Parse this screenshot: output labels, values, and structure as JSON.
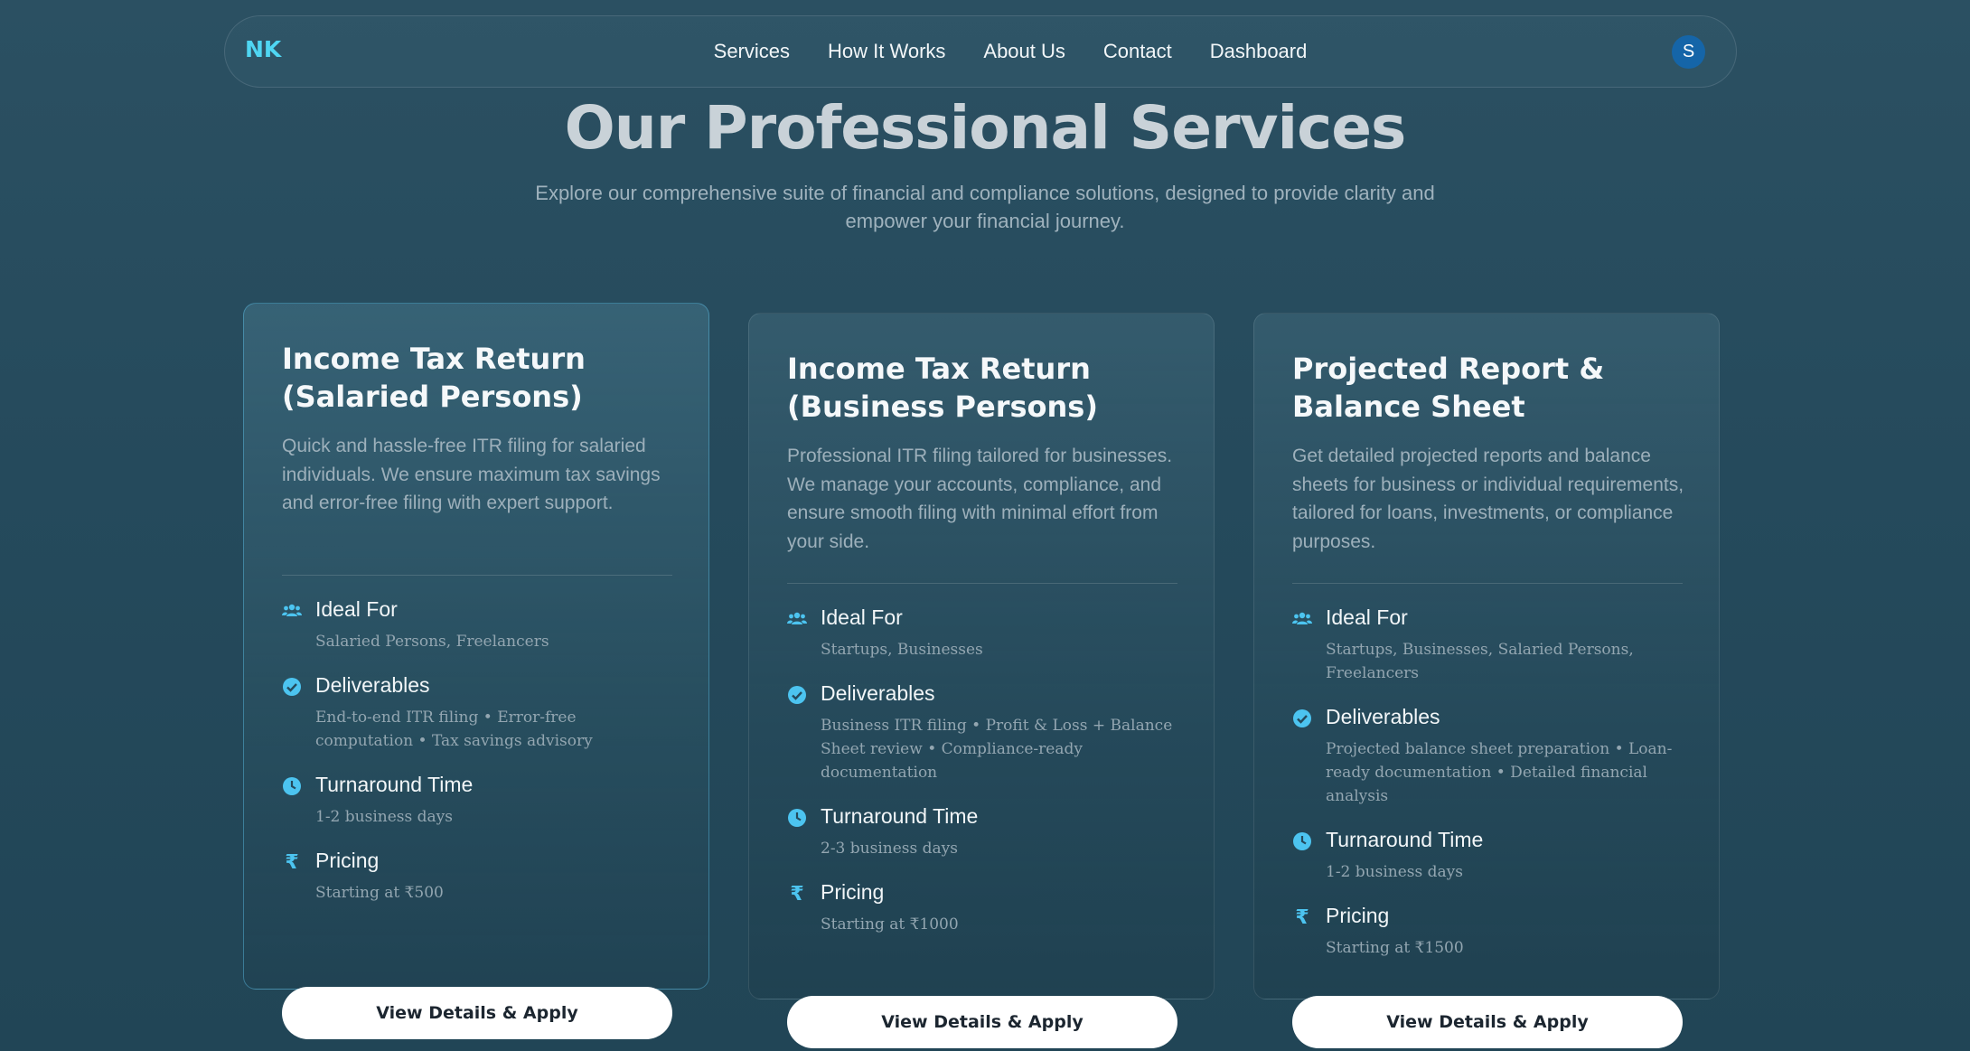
{
  "nav": {
    "logo": "NK",
    "links": [
      "Services",
      "How It Works",
      "About Us",
      "Contact",
      "Dashboard"
    ],
    "avatar_initial": "S"
  },
  "hero": {
    "title": "Our Professional Services",
    "subtitle": "Explore our comprehensive suite of financial and compliance solutions, designed to provide clarity and empower your financial journey."
  },
  "cards": [
    {
      "title": "Income Tax Return (Salaried Persons)",
      "description": "Quick and hassle-free ITR filing for salaried individuals. We ensure maximum tax savings and error-free filing with expert support.",
      "features": [
        {
          "icon": "users-icon",
          "title": "Ideal For",
          "detail": "Salaried Persons, Freelancers"
        },
        {
          "icon": "check-circle-icon",
          "title": "Deliverables",
          "detail": "End-to-end ITR filing • Error-free computation • Tax savings advisory"
        },
        {
          "icon": "clock-icon",
          "title": "Turnaround Time",
          "detail": "1-2 business days"
        },
        {
          "icon": "rupee-icon",
          "title": "Pricing",
          "detail": "Starting at ₹500"
        }
      ],
      "cta": "View Details & Apply"
    },
    {
      "title": "Income Tax Return (Business Persons)",
      "description": "Professional ITR filing tailored for businesses. We manage your accounts, compliance, and ensure smooth filing with minimal effort from your side.",
      "features": [
        {
          "icon": "users-icon",
          "title": "Ideal For",
          "detail": "Startups, Businesses"
        },
        {
          "icon": "check-circle-icon",
          "title": "Deliverables",
          "detail": "Business ITR filing • Profit & Loss + Balance Sheet review • Compliance-ready documentation"
        },
        {
          "icon": "clock-icon",
          "title": "Turnaround Time",
          "detail": "2-3 business days"
        },
        {
          "icon": "rupee-icon",
          "title": "Pricing",
          "detail": "Starting at ₹1000"
        }
      ],
      "cta": "View Details & Apply"
    },
    {
      "title": "Projected Report & Balance Sheet",
      "description": "Get detailed projected reports and balance sheets for business or individual requirements, tailored for loans, investments, or compliance purposes.",
      "features": [
        {
          "icon": "users-icon",
          "title": "Ideal For",
          "detail": "Startups, Businesses, Salaried Persons, Freelancers"
        },
        {
          "icon": "check-circle-icon",
          "title": "Deliverables",
          "detail": "Projected balance sheet preparation • Loan-ready documentation • Detailed financial analysis"
        },
        {
          "icon": "clock-icon",
          "title": "Turnaround Time",
          "detail": "1-2 business days"
        },
        {
          "icon": "rupee-icon",
          "title": "Pricing",
          "detail": "Starting at ₹1500"
        }
      ],
      "cta": "View Details & Apply"
    }
  ]
}
